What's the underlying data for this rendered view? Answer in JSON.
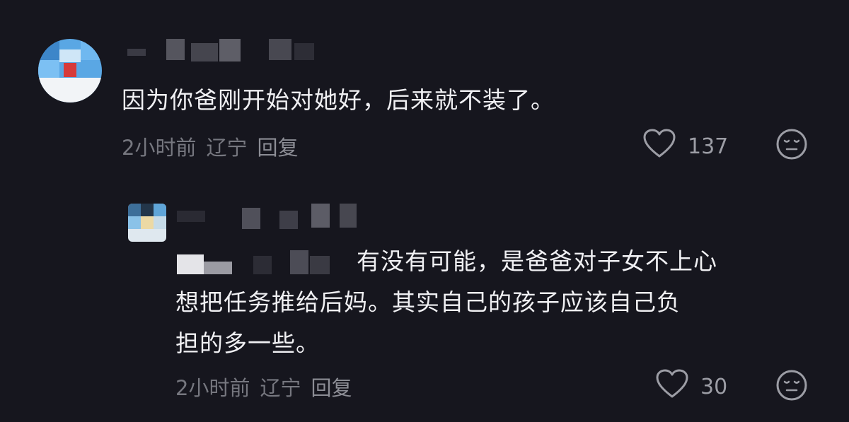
{
  "comments": [
    {
      "text": "因为你爸刚开始对她好，后来就不装了。",
      "time": "2小时前",
      "location": "辽宁",
      "reply_label": "回复",
      "likes": "137",
      "icons": {
        "like": "heart-outline-icon",
        "reaction": "neutral-face-icon"
      }
    },
    {
      "text_line1": "有没有可能，是爸爸对子女不上心",
      "text_line2": "想把任务推给后妈。其实自己的孩子应该自己负",
      "text_line3": "担的多一些。",
      "time": "2小时前",
      "location": "辽宁",
      "reply_label": "回复",
      "likes": "30",
      "icons": {
        "like": "heart-outline-icon",
        "reaction": "neutral-face-icon"
      }
    }
  ],
  "colors": {
    "background": "#16161e",
    "text": "#f0f0f3",
    "meta": "#76777f",
    "icon": "#9c9da5"
  }
}
